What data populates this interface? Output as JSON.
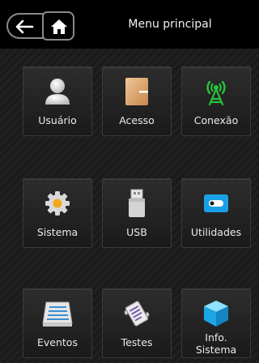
{
  "header": {
    "title": "Menu principal"
  },
  "tiles": [
    {
      "label": "Usuário",
      "icon": "user-icon"
    },
    {
      "label": "Acesso",
      "icon": "door-icon"
    },
    {
      "label": "Conexão",
      "icon": "antenna-icon"
    },
    {
      "label": "Sistema",
      "icon": "gear-icon"
    },
    {
      "label": "USB",
      "icon": "usb-icon"
    },
    {
      "label": "Utilidades",
      "icon": "utilities-icon"
    },
    {
      "label": "Eventos",
      "icon": "events-icon"
    },
    {
      "label": "Testes",
      "icon": "tests-icon"
    },
    {
      "label_line1": "Info.",
      "label_line2": "Sistema",
      "icon": "cube-icon"
    }
  ]
}
